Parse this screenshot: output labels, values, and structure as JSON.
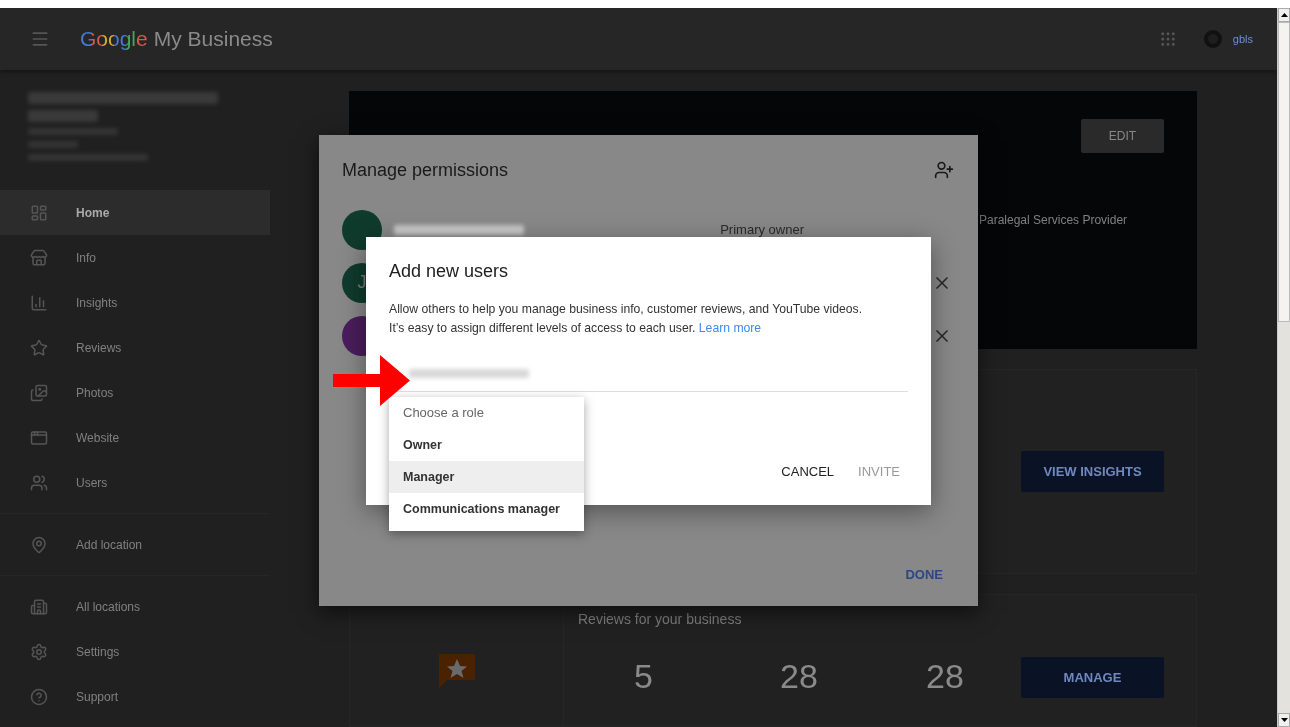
{
  "app_bar": {
    "logo_google": "Google",
    "logo_product": "My Business",
    "account_label": "gbls"
  },
  "sidebar": {
    "groups": [
      [
        {
          "label": "Home",
          "selected": true
        },
        {
          "label": "Info",
          "selected": false
        },
        {
          "label": "Insights",
          "selected": false
        },
        {
          "label": "Reviews",
          "selected": false
        },
        {
          "label": "Photos",
          "selected": false
        },
        {
          "label": "Website",
          "selected": false
        },
        {
          "label": "Users",
          "selected": false
        }
      ],
      [
        {
          "label": "Add location",
          "selected": false
        }
      ],
      [
        {
          "label": "All locations",
          "selected": false
        },
        {
          "label": "Settings",
          "selected": false
        },
        {
          "label": "Support",
          "selected": false
        }
      ]
    ]
  },
  "banner": {
    "category": "Paralegal Services Provider",
    "edit_button": "EDIT"
  },
  "insights_card": {
    "button": "VIEW INSIGHTS"
  },
  "reviews_card": {
    "title": "Reviews for your business",
    "stats": [
      "5",
      "28",
      "28"
    ],
    "button": "MANAGE"
  },
  "manage_permissions": {
    "title": "Manage permissions",
    "users": [
      {
        "color": "#0f3b2d",
        "role": "Primary owner",
        "removable": false
      },
      {
        "color": "#0f3b2d",
        "initial": "J",
        "removable": true
      },
      {
        "color": "#4a1d5c",
        "removable": true
      }
    ],
    "done_button": "DONE"
  },
  "add_users": {
    "title": "Add new users",
    "description": "Allow others to help you manage business info, customer reviews, and YouTube videos. It’s easy to assign different levels of access to each user.",
    "link": "Learn more",
    "buttons": [
      {
        "label": "CANCEL",
        "disabled": false
      },
      {
        "label": "INVITE",
        "disabled": true
      }
    ]
  },
  "role_menu": {
    "heading": "Choose a role",
    "options": [
      {
        "label": "Owner",
        "selected": false
      },
      {
        "label": "Manager",
        "selected": true
      },
      {
        "label": "Communications manager",
        "selected": false
      }
    ]
  }
}
